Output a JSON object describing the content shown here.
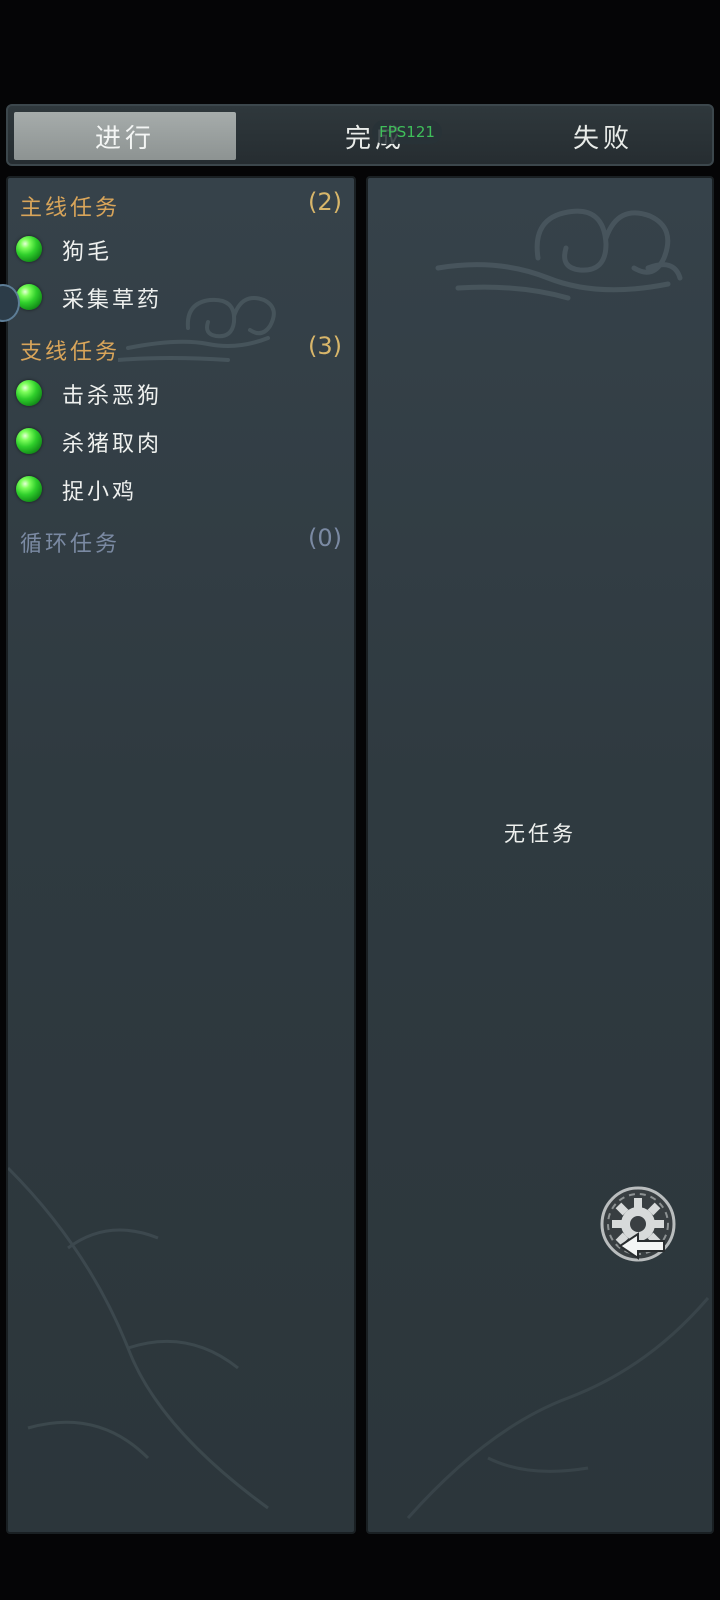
{
  "tabs": [
    {
      "label": "进行",
      "active": true
    },
    {
      "label": "完成",
      "active": false
    },
    {
      "label": "失败",
      "active": false
    }
  ],
  "fps_overlay": "FPS121",
  "quest_list": {
    "main": {
      "title": "主线任务",
      "count": "(2)",
      "items": [
        "狗毛",
        "采集草药"
      ]
    },
    "side": {
      "title": "支线任务",
      "count": "(3)",
      "items": [
        "击杀恶狗",
        "杀猪取肉",
        "捉小鸡"
      ]
    },
    "loop": {
      "title": "循环任务",
      "count": "(0)",
      "items": []
    }
  },
  "detail": {
    "empty_text": "无任务"
  },
  "icons": {
    "quest_orb": "green-orb-icon",
    "settings_back": "gear-back-icon"
  },
  "colors": {
    "category_gold": "#d9a55a",
    "category_gray": "#7b8aa3",
    "orb_green": "#2fcf2b"
  }
}
